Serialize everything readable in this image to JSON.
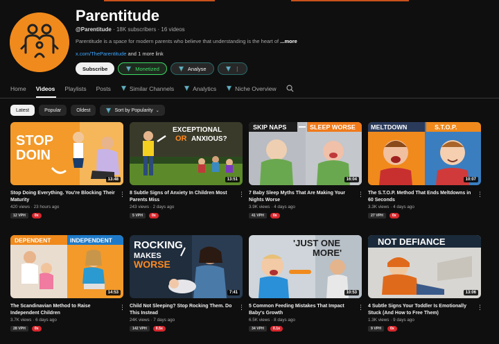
{
  "channel": {
    "name": "Parentitude",
    "handle": "@Parentitude",
    "subscribers": "18K subscribers",
    "videos_count": "16 videos",
    "description": "Parentitude is a space for modern parents who believe that understanding is the heart of",
    "more_label": "...more",
    "link": "x.com/TheParentitude",
    "more_links": "and 1 more link"
  },
  "buttons": {
    "subscribe": "Subscribe",
    "monetized": "Monetized",
    "analyse": "Analyse",
    "kebab": "⋮"
  },
  "tabs": [
    "Home",
    "Videos",
    "Playlists",
    "Posts",
    "Similar Channels",
    "Analytics",
    "Niche Overview"
  ],
  "filters": {
    "latest": "Latest",
    "popular": "Popular",
    "oldest": "Oldest",
    "sort": "Sort by Popularity"
  },
  "videos": [
    {
      "title": "Stop Doing Everything. You're Blocking Their Maturity",
      "views": "420 views",
      "age": "23 hours ago",
      "duration": "13:48",
      "vph": "12 VPH",
      "x": "0x",
      "thumb_text": [
        "STOP",
        "DOIN"
      ]
    },
    {
      "title": "8 Subtle Signs of Anxiety In Children Most Parents Miss",
      "views": "243 views",
      "age": "2 days ago",
      "duration": "13:51",
      "vph": "5 VPH",
      "x": "0x",
      "thumb_text": [
        "EXCEPTIONAL",
        "OR",
        "ANXIOUS?"
      ]
    },
    {
      "title": "7 Baby Sleep Myths That Are Making Your Nights Worse",
      "views": "3.9K views",
      "age": "4 days ago",
      "duration": "16:04",
      "vph": "41 VPH",
      "x": "0x",
      "thumb_text": [
        "SKIP NAPS",
        "SLEEP WORSE"
      ]
    },
    {
      "title": "The S.T.O.P. Method That Ends Meltdowns in 60 Seconds",
      "views": "3.3K views",
      "age": "4 days ago",
      "duration": "10:07",
      "vph": "27 VPH",
      "x": "0x",
      "thumb_text": [
        "MELTDOWN",
        "S.T.O.P."
      ]
    },
    {
      "title": "The Scandinavian Method to Raise Independent Children",
      "views": "3.7K views",
      "age": "6 days ago",
      "duration": "14:53",
      "vph": "28 VPH",
      "x": "0x",
      "thumb_text": [
        "DEPENDENT",
        "INDEPENDENT"
      ]
    },
    {
      "title": "Child Not Sleeping? Stop Rocking Them. Do This Instead",
      "views": "24K views",
      "age": "7 days ago",
      "duration": "7:41",
      "vph": "142 VPH",
      "x": "0.5x",
      "thumb_text": [
        "ROCKING",
        "MAKES",
        "WORSE"
      ]
    },
    {
      "title": "5 Common Feeding Mistakes That Impact Baby's Growth",
      "views": "6.5K views",
      "age": "8 days ago",
      "duration": "10:53",
      "vph": "34 VPH",
      "x": "0.1x",
      "thumb_text": [
        "'JUST ONE",
        "MORE'"
      ]
    },
    {
      "title": "4 Subtle Signs Your Toddler Is Emotionally Stuck (And How to Free Them)",
      "views": "1.3K views",
      "age": "9 days ago",
      "duration": "13:06",
      "vph": "9 VPH",
      "x": "0x",
      "thumb_text": [
        "NOT DEFIANCE"
      ]
    }
  ],
  "colors": {
    "brand_orange": "#f08a1c",
    "accent_red": "#d7262d",
    "monetized_green": "#3ddc66"
  }
}
